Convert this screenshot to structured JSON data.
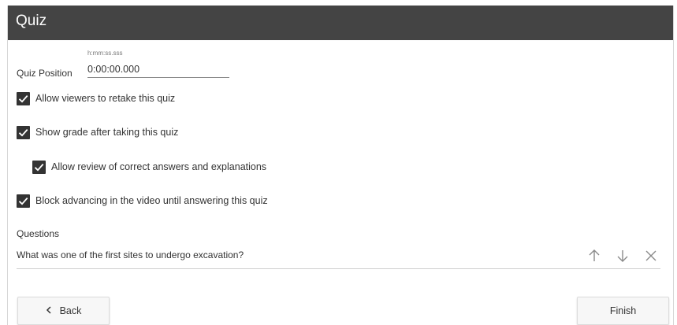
{
  "header": {
    "title": "Quiz"
  },
  "position": {
    "label": "Quiz Position",
    "format_hint": "h:mm:ss.sss",
    "value": "0:00:00.000"
  },
  "options": [
    {
      "label": "Allow viewers to retake this quiz",
      "checked": true
    },
    {
      "label": "Show grade after taking this quiz",
      "checked": true
    },
    {
      "label": "Allow review of correct answers and explanations",
      "checked": true
    },
    {
      "label": "Block advancing in the video until answering this quiz",
      "checked": true
    }
  ],
  "questions": {
    "heading": "Questions",
    "items": [
      {
        "text": "What was one of the first sites to undergo excavation?"
      }
    ],
    "icons": [
      "arrow-up-icon",
      "arrow-down-icon",
      "close-icon"
    ]
  },
  "footer": {
    "back_label": "Back",
    "finish_label": "Finish"
  },
  "colors": {
    "header_bg": "#444444",
    "checkbox_fill": "#333333",
    "text": "#333333"
  }
}
